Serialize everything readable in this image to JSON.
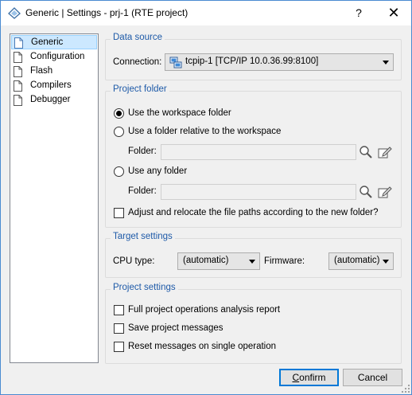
{
  "window": {
    "title": "Generic | Settings - prj-1 (RTE project)",
    "help_glyph": "?",
    "close_glyph": "✕"
  },
  "nav": {
    "items": [
      {
        "label": "Generic",
        "selected": true
      },
      {
        "label": "Configuration",
        "selected": false
      },
      {
        "label": "Flash",
        "selected": false
      },
      {
        "label": "Compilers",
        "selected": false
      },
      {
        "label": "Debugger",
        "selected": false
      }
    ]
  },
  "data_source": {
    "legend": "Data source",
    "connection_label": "Connection:",
    "connection_value": "tcpip-1 [TCP/IP 10.0.36.99:8100]"
  },
  "project_folder": {
    "legend": "Project folder",
    "use_workspace_label": "Use the workspace folder",
    "use_workspace_checked": true,
    "use_relative_label": "Use a folder relative to the workspace",
    "use_relative_checked": false,
    "folder_label_1": "Folder:",
    "folder_value_1": "",
    "use_any_label": "Use any folder",
    "use_any_checked": false,
    "folder_label_2": "Folder:",
    "folder_value_2": "",
    "adjust_label": "Adjust and relocate the file paths according to the new folder?",
    "adjust_checked": false
  },
  "target_settings": {
    "legend": "Target settings",
    "cpu_label": "CPU type:",
    "cpu_value": "(automatic)",
    "firmware_label": "Firmware:",
    "firmware_value": "(automatic)"
  },
  "project_settings": {
    "legend": "Project settings",
    "full_report_label": "Full project operations analysis report",
    "full_report_checked": false,
    "save_messages_label": "Save project messages",
    "save_messages_checked": false,
    "reset_messages_label": "Reset messages on single operation",
    "reset_messages_checked": false
  },
  "footer": {
    "confirm_first": "C",
    "confirm_rest": "onfirm",
    "cancel_label": "Cancel"
  },
  "colors": {
    "accent": "#0078d7",
    "legend_text": "#1e5aa8",
    "selection_bg": "#cce8ff"
  }
}
